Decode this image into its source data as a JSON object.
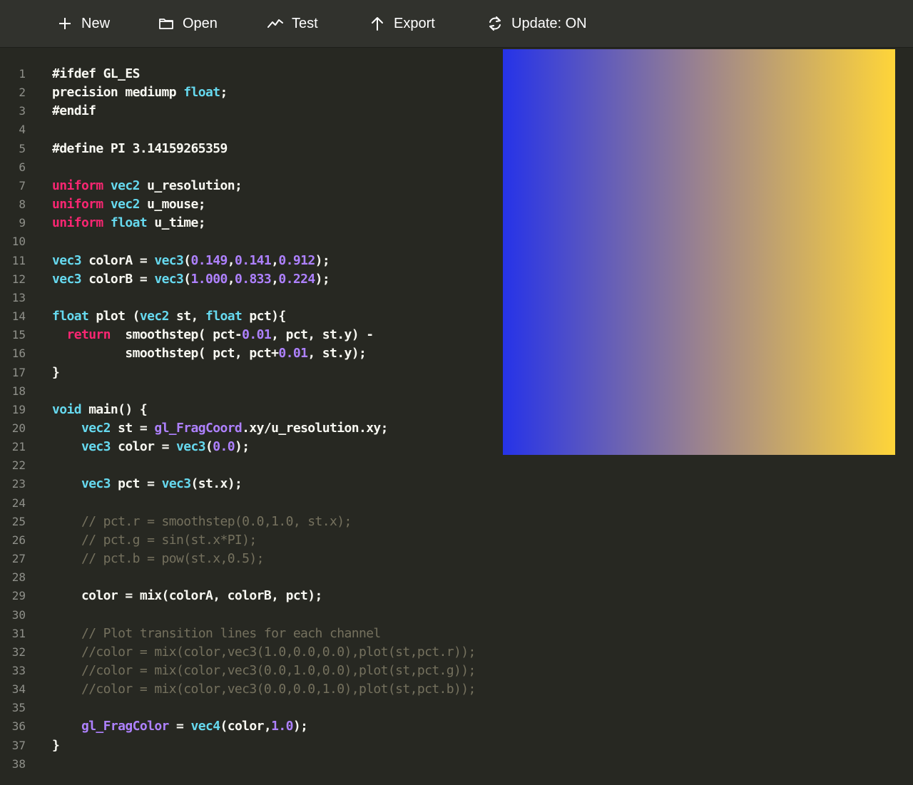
{
  "toolbar": {
    "new_label": "New",
    "open_label": "Open",
    "test_label": "Test",
    "export_label": "Export",
    "update_label": "Update: ON"
  },
  "preview": {
    "color_a": "#2633e8",
    "color_b": "#ffd539"
  },
  "editor": {
    "lines": [
      [
        [
          "d",
          "#ifdef GL_ES"
        ]
      ],
      [
        [
          "d",
          "precision mediump "
        ],
        [
          "t",
          "float"
        ],
        [
          "d",
          ";"
        ]
      ],
      [
        [
          "d",
          "#endif"
        ]
      ],
      [],
      [
        [
          "d",
          "#define PI 3.14159265359"
        ]
      ],
      [],
      [
        [
          "k",
          "uniform"
        ],
        [
          "d",
          " "
        ],
        [
          "t",
          "vec2"
        ],
        [
          "d",
          " u_resolution;"
        ]
      ],
      [
        [
          "k",
          "uniform"
        ],
        [
          "d",
          " "
        ],
        [
          "t",
          "vec2"
        ],
        [
          "d",
          " u_mouse;"
        ]
      ],
      [
        [
          "k",
          "uniform"
        ],
        [
          "d",
          " "
        ],
        [
          "t",
          "float"
        ],
        [
          "d",
          " u_time;"
        ]
      ],
      [],
      [
        [
          "t",
          "vec3"
        ],
        [
          "d",
          " colorA = "
        ],
        [
          "t",
          "vec3"
        ],
        [
          "d",
          "("
        ],
        [
          "n",
          "0.149"
        ],
        [
          "d",
          ","
        ],
        [
          "n",
          "0.141"
        ],
        [
          "d",
          ","
        ],
        [
          "n",
          "0.912"
        ],
        [
          "d",
          ");"
        ]
      ],
      [
        [
          "t",
          "vec3"
        ],
        [
          "d",
          " colorB = "
        ],
        [
          "t",
          "vec3"
        ],
        [
          "d",
          "("
        ],
        [
          "n",
          "1.000"
        ],
        [
          "d",
          ","
        ],
        [
          "n",
          "0.833"
        ],
        [
          "d",
          ","
        ],
        [
          "n",
          "0.224"
        ],
        [
          "d",
          ");"
        ]
      ],
      [],
      [
        [
          "t",
          "float"
        ],
        [
          "d",
          " plot ("
        ],
        [
          "t",
          "vec2"
        ],
        [
          "d",
          " st, "
        ],
        [
          "t",
          "float"
        ],
        [
          "d",
          " pct){"
        ]
      ],
      [
        [
          "d",
          "  "
        ],
        [
          "k",
          "return"
        ],
        [
          "d",
          "  smoothstep( pct-"
        ],
        [
          "n",
          "0.01"
        ],
        [
          "d",
          ", pct, st.y) -"
        ]
      ],
      [
        [
          "d",
          "          smoothstep( pct, pct+"
        ],
        [
          "n",
          "0.01"
        ],
        [
          "d",
          ", st.y);"
        ]
      ],
      [
        [
          "d",
          "}"
        ]
      ],
      [],
      [
        [
          "t",
          "void"
        ],
        [
          "d",
          " main() {"
        ]
      ],
      [
        [
          "d",
          "    "
        ],
        [
          "t",
          "vec2"
        ],
        [
          "d",
          " st = "
        ],
        [
          "n",
          "gl_FragCoord"
        ],
        [
          "d",
          ".xy/u_resolution.xy;"
        ]
      ],
      [
        [
          "d",
          "    "
        ],
        [
          "t",
          "vec3"
        ],
        [
          "d",
          " color = "
        ],
        [
          "t",
          "vec3"
        ],
        [
          "d",
          "("
        ],
        [
          "n",
          "0.0"
        ],
        [
          "d",
          ");"
        ]
      ],
      [],
      [
        [
          "d",
          "    "
        ],
        [
          "t",
          "vec3"
        ],
        [
          "d",
          " pct = "
        ],
        [
          "t",
          "vec3"
        ],
        [
          "d",
          "(st.x);"
        ]
      ],
      [],
      [
        [
          "d",
          "    "
        ],
        [
          "c",
          "// pct.r = smoothstep(0.0,1.0, st.x);"
        ]
      ],
      [
        [
          "d",
          "    "
        ],
        [
          "c",
          "// pct.g = sin(st.x*PI);"
        ]
      ],
      [
        [
          "d",
          "    "
        ],
        [
          "c",
          "// pct.b = pow(st.x,0.5);"
        ]
      ],
      [],
      [
        [
          "d",
          "    color = mix(colorA, colorB, pct);"
        ]
      ],
      [],
      [
        [
          "d",
          "    "
        ],
        [
          "c",
          "// Plot transition lines for each channel"
        ]
      ],
      [
        [
          "d",
          "    "
        ],
        [
          "c",
          "//color = mix(color,vec3(1.0,0.0,0.0),plot(st,pct.r));"
        ]
      ],
      [
        [
          "d",
          "    "
        ],
        [
          "c",
          "//color = mix(color,vec3(0.0,1.0,0.0),plot(st,pct.g));"
        ]
      ],
      [
        [
          "d",
          "    "
        ],
        [
          "c",
          "//color = mix(color,vec3(0.0,0.0,1.0),plot(st,pct.b));"
        ]
      ],
      [],
      [
        [
          "d",
          "    "
        ],
        [
          "n",
          "gl_FragColor"
        ],
        [
          "d",
          " = "
        ],
        [
          "t",
          "vec4"
        ],
        [
          "d",
          "(color,"
        ],
        [
          "n",
          "1.0"
        ],
        [
          "d",
          ");"
        ]
      ],
      [
        [
          "d",
          "}"
        ]
      ],
      []
    ]
  }
}
